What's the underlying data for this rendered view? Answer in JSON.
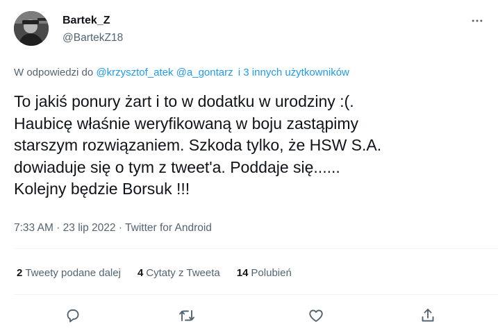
{
  "author": {
    "name": "Bartek_Z",
    "handle": "@BartekZ18"
  },
  "reply": {
    "prefix": "W odpowiedzi do",
    "mention_1": "@krzysztof_atek",
    "mention_2": "@a_gontarz",
    "others": "i 3 innych użytkowników"
  },
  "tweet": {
    "text": "To jakiś ponury żart i to w dodatku w urodziny :(.\nHaubicę właśnie weryfikowaną w boju zastąpimy\nstarszym rozwiązaniem. Szkoda tylko, że HSW S.A.\ndowiaduje się o tym z tweet'a. Poddaje się......\nKolejny będzie Borsuk !!!"
  },
  "meta": {
    "time": "7:33 AM",
    "date": "23 lip 2022",
    "source": "Twitter for Android"
  },
  "stats": {
    "retweets_count": "2",
    "retweets_label": "Tweety podane dalej",
    "quotes_count": "4",
    "quotes_label": "Cytaty z Tweeta",
    "likes_count": "14",
    "likes_label": "Polubień"
  },
  "icons": {
    "more": "more-horizontal-icon",
    "reply": "reply-icon",
    "retweet": "retweet-icon",
    "like": "heart-icon",
    "share": "share-icon"
  },
  "colors": {
    "accent": "#1d9bf0",
    "secondary_text": "#536471",
    "primary_text": "#0f1419"
  }
}
